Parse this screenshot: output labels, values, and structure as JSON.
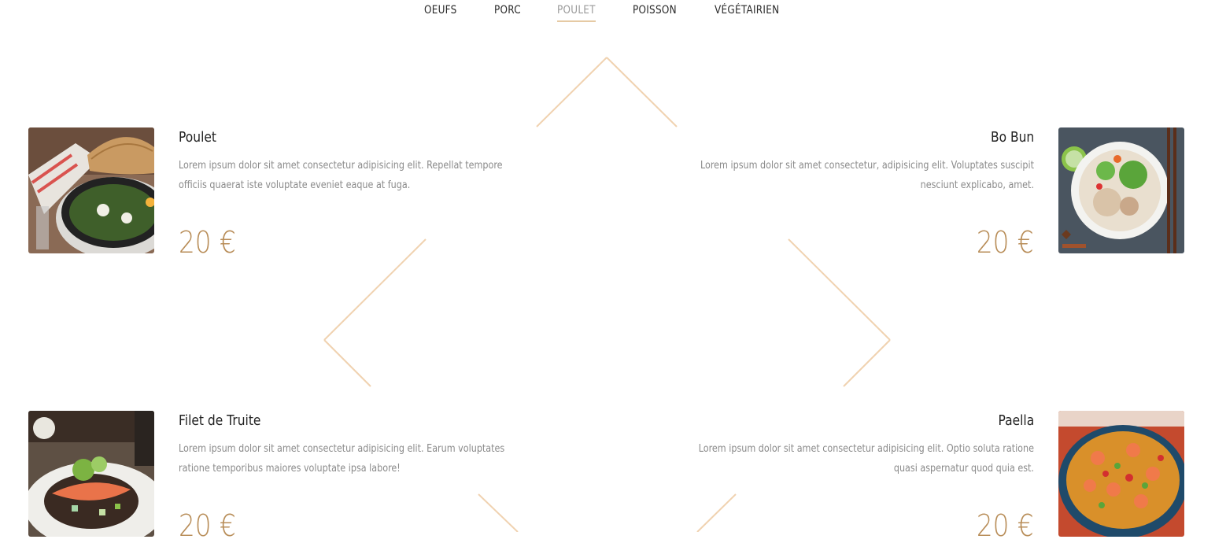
{
  "tabs": [
    {
      "label": "OEUFS",
      "active": false
    },
    {
      "label": "PORC",
      "active": false
    },
    {
      "label": "POULET",
      "active": true
    },
    {
      "label": "POISSON",
      "active": false
    },
    {
      "label": "VÉGÉTAIRIEN",
      "active": false
    }
  ],
  "accent_color": "#b88d58",
  "line_color": "#f0d2b0",
  "dishes": [
    {
      "name": "Poulet",
      "description": "Lorem ipsum dolor sit amet consectetur adipisicing elit. Repellat tempore officiis quaerat iste voluptate eveniet eaque at fuga.",
      "price": "20 €",
      "image": "shakshuka-skillet-with-bread"
    },
    {
      "name": "Bo Bun",
      "description": "Lorem ipsum dolor sit amet consectetur, adipisicing elit. Voluptates suscipit nesciunt explicabo, amet.",
      "price": "20 €",
      "image": "noodle-bowl-with-chopsticks"
    },
    {
      "name": "Filet de Truite",
      "description": "Lorem ipsum dolor sit amet consectetur adipisicing elit. Earum voluptates ratione temporibus maiores voluptate ipsa labore!",
      "price": "20 €",
      "image": "trout-fillet-plate"
    },
    {
      "name": "Paella",
      "description": "Lorem ipsum dolor sit amet consectetur adipisicing elit. Optio soluta ratione quasi aspernatur quod quia est.",
      "price": "20 €",
      "image": "paella-pan-with-shrimp"
    }
  ]
}
